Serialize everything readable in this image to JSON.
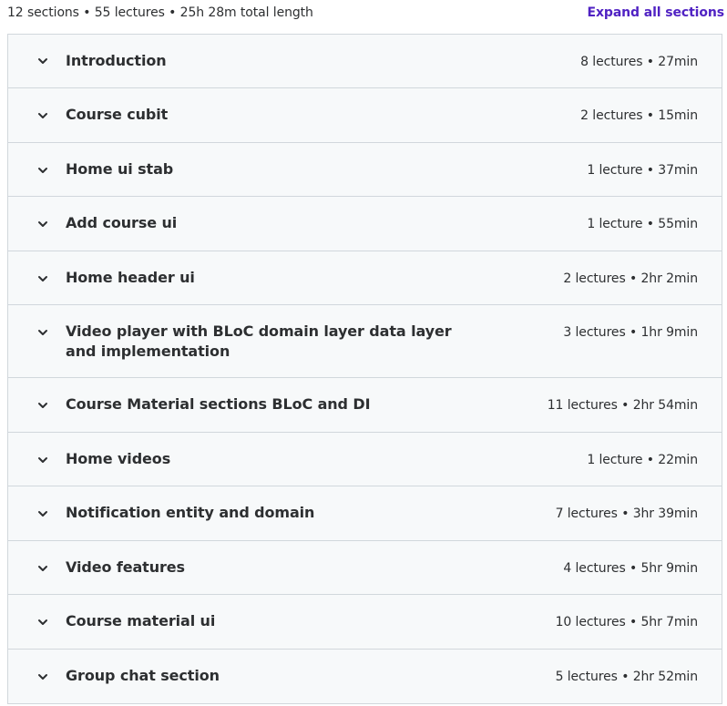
{
  "summary": {
    "text": "12 sections • 55 lectures • 25h 28m total length",
    "expand_label": "Expand all sections"
  },
  "sections": [
    {
      "title": "Introduction",
      "meta": "8 lectures • 27min"
    },
    {
      "title": "Course cubit",
      "meta": "2 lectures • 15min"
    },
    {
      "title": "Home ui stab",
      "meta": "1 lecture • 37min"
    },
    {
      "title": "Add course ui",
      "meta": "1 lecture • 55min"
    },
    {
      "title": "Home header ui",
      "meta": "2 lectures • 2hr 2min"
    },
    {
      "title": "Video player with BLoC domain layer data layer and implementation",
      "meta": "3 lectures • 1hr 9min"
    },
    {
      "title": "Course Material sections BLoC and DI",
      "meta": "11 lectures • 2hr 54min"
    },
    {
      "title": "Home videos",
      "meta": "1 lecture • 22min"
    },
    {
      "title": "Notification entity and domain",
      "meta": "7 lectures • 3hr 39min"
    },
    {
      "title": "Video features",
      "meta": "4 lectures • 5hr 9min"
    },
    {
      "title": "Course material ui",
      "meta": "10 lectures • 5hr 7min"
    },
    {
      "title": "Group chat section",
      "meta": "5 lectures • 2hr 52min"
    }
  ],
  "colors": {
    "accent": "#5022c3",
    "text": "#2d2f31",
    "border": "#d1d7dc",
    "row_bg": "#f7f9fa"
  },
  "icons": {
    "section_toggle": "chevron-down-icon"
  }
}
